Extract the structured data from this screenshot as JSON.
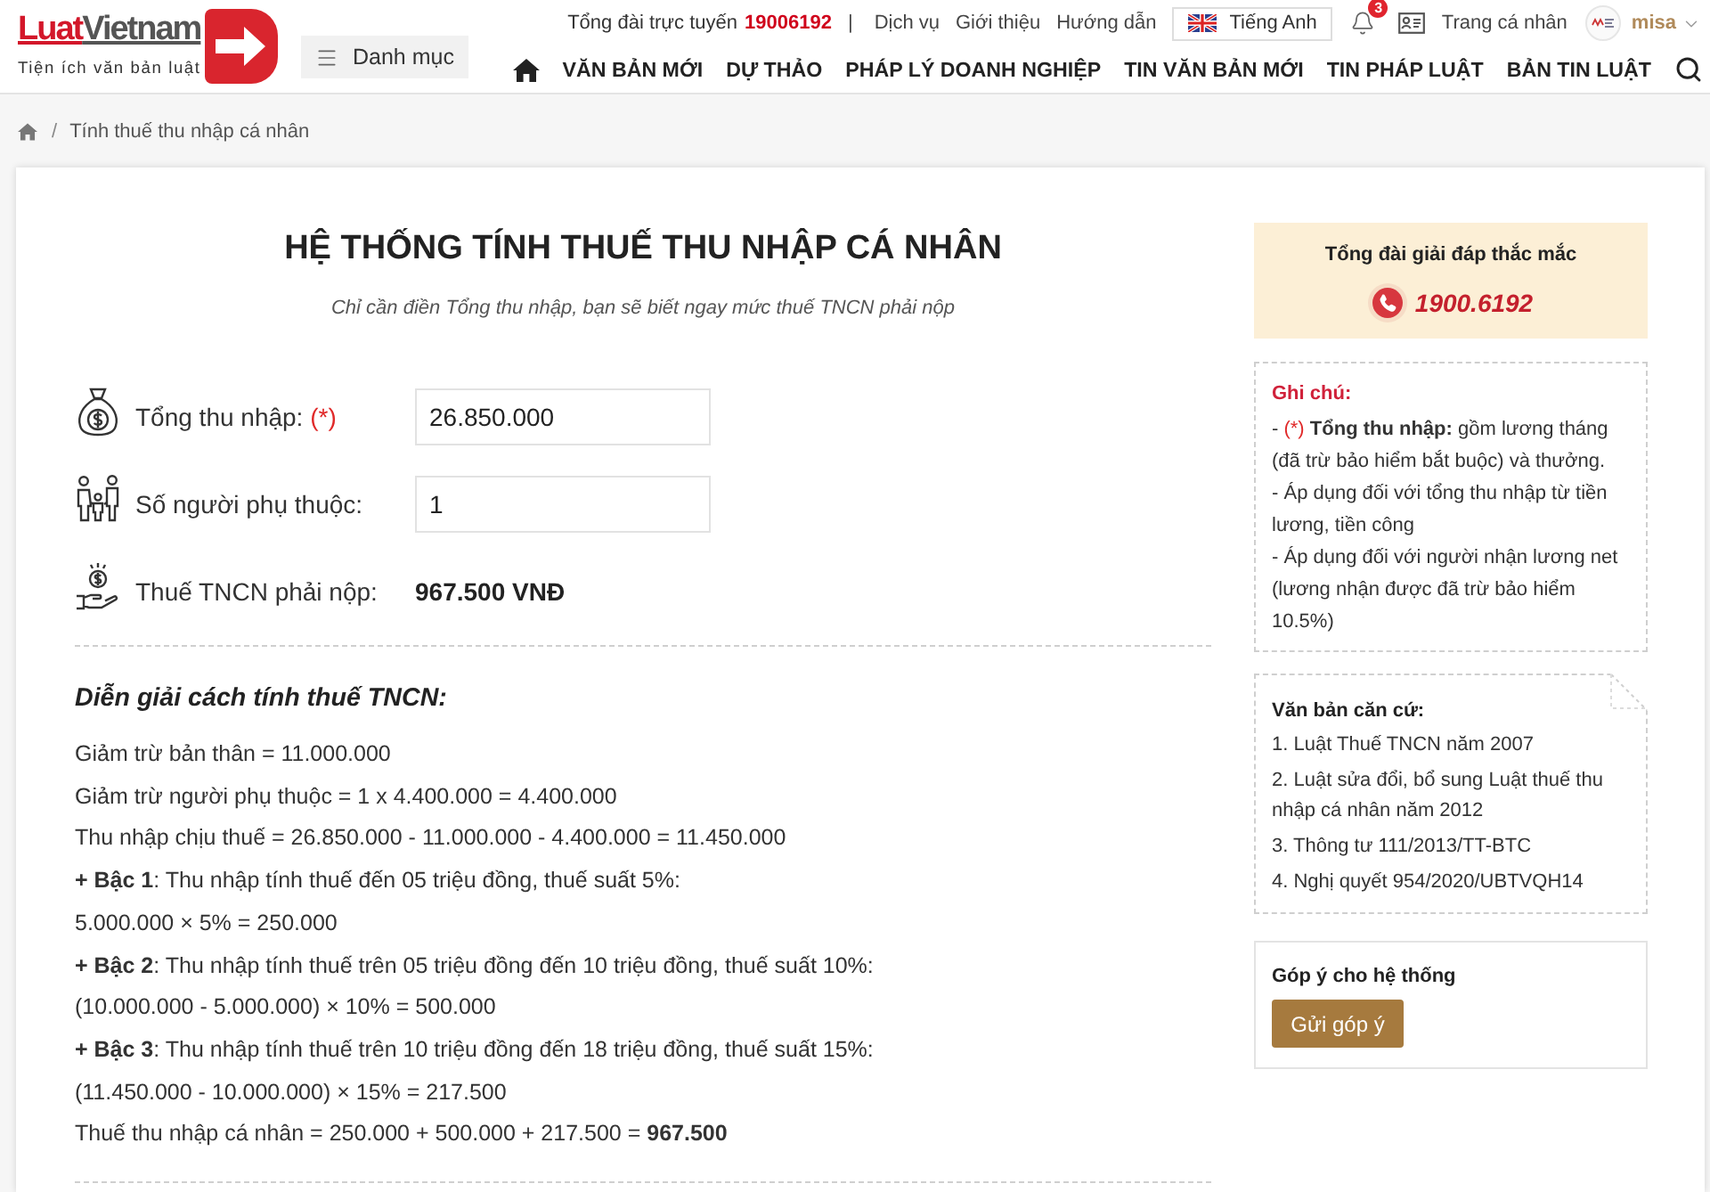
{
  "header": {
    "logo": {
      "brand_accent": "Luat",
      "brand_rest": "Vietnam",
      "tagline": "Tiện ích văn bản luật"
    },
    "menu_button": "Danh mục",
    "hotline": {
      "label": "Tổng đài trực tuyến",
      "number": "19006192"
    },
    "separator": "|",
    "top_links": [
      "Dịch vụ",
      "Giới thiệu",
      "Hướng dẫn"
    ],
    "language_button": "Tiếng Anh",
    "notification_count": "3",
    "profile_link": "Trang cá nhân",
    "user_name": "misa",
    "nav": [
      "VĂN BẢN MỚI",
      "DỰ THẢO",
      "PHÁP LÝ DOANH NGHIỆP",
      "TIN VĂN BẢN MỚI",
      "TIN PHÁP LUẬT",
      "BẢN TIN LUẬT"
    ]
  },
  "breadcrumb": {
    "separator": "/",
    "items": [
      "Tính thuế thu nhập cá nhân"
    ]
  },
  "calculator": {
    "title": "HỆ THỐNG TÍNH THUẾ THU NHẬP CÁ NHÂN",
    "subtitle": "Chỉ cần điền Tổng thu nhập, bạn sẽ biết ngay mức thuế TNCN phải nộp",
    "fields": [
      {
        "kind": "input",
        "label": "Tổng thu nhập:",
        "required_mark": "(*)",
        "value": "26.850.000"
      },
      {
        "kind": "input",
        "label": "Số người phụ thuộc:",
        "value": "1"
      },
      {
        "kind": "result",
        "label": "Thuế TNCN phải nộp:",
        "value": "967.500 VNĐ"
      }
    ]
  },
  "explanation": {
    "title": "Diễn giải cách tính thuế TNCN:",
    "lines": [
      "Giảm trừ bản thân = 11.000.000",
      "Giảm trừ người phụ thuộc = 1 x 4.400.000 = 4.400.000",
      "Thu nhập chịu thuế = 26.850.000 - 11.000.000 - 4.400.000 = 11.450.000",
      "**+ Bậc 1**: Thu nhập tính thuế đến 05 triệu đồng, thuế suất 5%:",
      "5.000.000 × 5% = 250.000",
      "**+ Bậc 2**: Thu nhập tính thuế trên 05 triệu đồng đến 10 triệu đồng, thuế suất 10%:",
      "(10.000.000 - 5.000.000) × 10% = 500.000",
      "**+ Bậc 3**: Thu nhập tính thuế trên 10 triệu đồng đến 18 triệu đồng, thuế suất 15%:",
      "(11.450.000 - 10.000.000) × 15% = 217.500",
      "Thuế thu nhập cá nhân = 250.000 + 500.000 + 217.500 = **967.500**"
    ]
  },
  "sidebar": {
    "hotline_box": {
      "title": "Tổng đài giải đáp thắc mắc",
      "number": "1900.6192"
    },
    "notes": {
      "title": "Ghi chú:",
      "items": [
        {
          "bullet": "-",
          "required_mark": "(*)",
          "text": "**Tổng thu nhập:** gồm lương tháng (đã trừ bảo hiểm bắt buộc) và thưởng."
        },
        {
          "bullet": "-",
          "text": "Áp dụng đối với tổng thu nhập từ tiền lương, tiền công"
        },
        {
          "bullet": "-",
          "text": "Áp dụng đối với người nhận lương net (lương nhận được đã trừ bảo hiểm 10.5%)"
        }
      ]
    },
    "legal_basis": {
      "title": "Văn bản căn cứ:",
      "items": [
        "1. Luật Thuế TNCN năm 2007",
        "2. Luật sửa đổi, bổ sung Luật thuế thu nhập cá nhân năm 2012",
        "3. Thông tư 111/2013/TT-BTC",
        "4. Nghị quyết 954/2020/UBTVQH14"
      ]
    },
    "feedback": {
      "title": "Góp ý cho hệ thống",
      "button": "Gửi góp ý"
    }
  }
}
